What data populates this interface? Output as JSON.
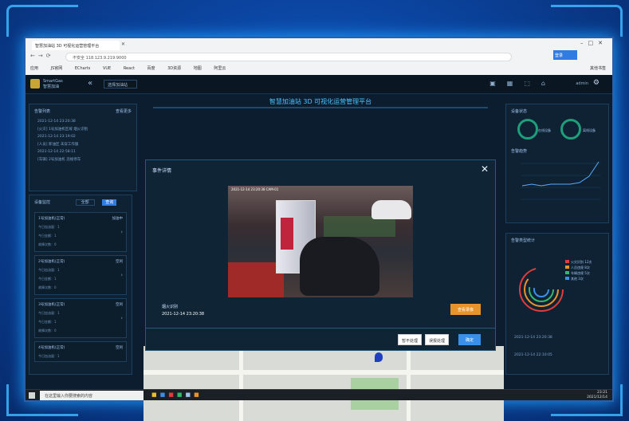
{
  "browser": {
    "tab_title": "智慧加油站 3D 可视化运营管理平台",
    "address": "不安全  118.123.9.219:9000",
    "login_label": "登录",
    "bookmarks": [
      "应用",
      "JS官网",
      "ECharts",
      "VUE",
      "React",
      "百度",
      "3D资源",
      "地图",
      "阿里云"
    ],
    "bookmarks_right": "其他书签"
  },
  "app": {
    "logo_line1": "SmartGas",
    "logo_line2": "智慧加油",
    "station_select": "选择加油站",
    "user": "admin",
    "title": "智慧加油站 3D 可视化运营管理平台"
  },
  "left_top": {
    "title": "告警列表",
    "more": "查看更多",
    "items": [
      "2021-12-14 23:20:38",
      "[火灾] 1号加油机区域 烟火识别",
      "2021-12-14 23:19:02",
      "[人员] 卸油区 未穿工作服",
      "2021-12-14 22:58:11",
      "[车辆] 2号加油机 违规停车"
    ]
  },
  "left_bottom": {
    "title": "设备监控",
    "select": "全部",
    "button": "查询",
    "cards": [
      {
        "title": "1号加油机(正常)",
        "status": "加油中",
        "row1": "今日加油量：1",
        "row2": "今日金额：1",
        "row3": "故障次数：0"
      },
      {
        "title": "2号加油机(正常)",
        "status": "空闲",
        "row1": "今日加油量：1",
        "row2": "今日金额：1",
        "row3": "故障次数：0"
      },
      {
        "title": "3号加油机(正常)",
        "status": "空闲",
        "row1": "今日加油量：1",
        "row2": "今日金额：1",
        "row3": "故障次数：0"
      },
      {
        "title": "4号加油机(正常)",
        "status": "空闲",
        "row1": "今日加油量：1"
      }
    ]
  },
  "right_top": {
    "title": "设备状态",
    "gauge1": "在线设备",
    "gauge2": "离线设备",
    "chart_title": "告警趋势"
  },
  "right_bottom": {
    "title": "告警类型统计",
    "legend": [
      "火灾识别 12次",
      "人员违规 8次",
      "车辆违规 5次",
      "其他 3次"
    ],
    "legend_colors": [
      "#e23b3b",
      "#e8932b",
      "#33b86a",
      "#3a8fe8"
    ],
    "items": [
      "2021-12-14 23:20:38",
      "2021-12-14 22:10:05"
    ]
  },
  "modal": {
    "title": "事件详情",
    "video_timestamp": "2021-12-14 23:20:38  CAM-01",
    "event_name": "烟火识别",
    "event_time": "2021-12-14 23:20:38",
    "orange_button": "查看录像",
    "btn_ignore": "暂不处理",
    "btn_misreport": "误报处理",
    "btn_confirm": "确定"
  },
  "taskbar": {
    "search": "在这里输入你要搜索的内容",
    "time": "23:21",
    "date": "2021/12/14"
  }
}
